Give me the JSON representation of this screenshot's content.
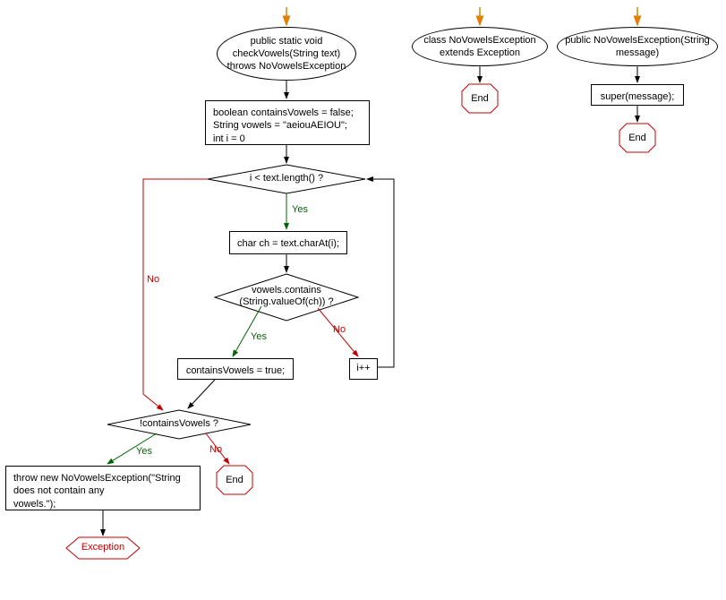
{
  "flowchart1": {
    "start": "public static void\ncheckVowels(String text)\nthrows NoVowelsException",
    "init": "boolean containsVowels = false;\nString vowels = \"aeiouAEIOU\";\nint i = 0",
    "cond1": "i < text.length() ?",
    "charAt": "char ch = text.charAt(i);",
    "cond2": "vowels.contains\n(String.valueOf(ch)) ?",
    "setTrue": "containsVowels = true;",
    "inc": "i++",
    "cond3": "!containsVowels ?",
    "throw": "throw new NoVowelsException(\"String\ndoes not contain any\nvowels.\");",
    "exception": "Exception",
    "end": "End"
  },
  "flowchart2": {
    "start": "class NoVowelsException\nextends Exception",
    "end": "End"
  },
  "flowchart3": {
    "start": "public NoVowelsException(String\nmessage)",
    "body": "super(message);",
    "end": "End"
  },
  "labels": {
    "yes": "Yes",
    "no": "No"
  }
}
